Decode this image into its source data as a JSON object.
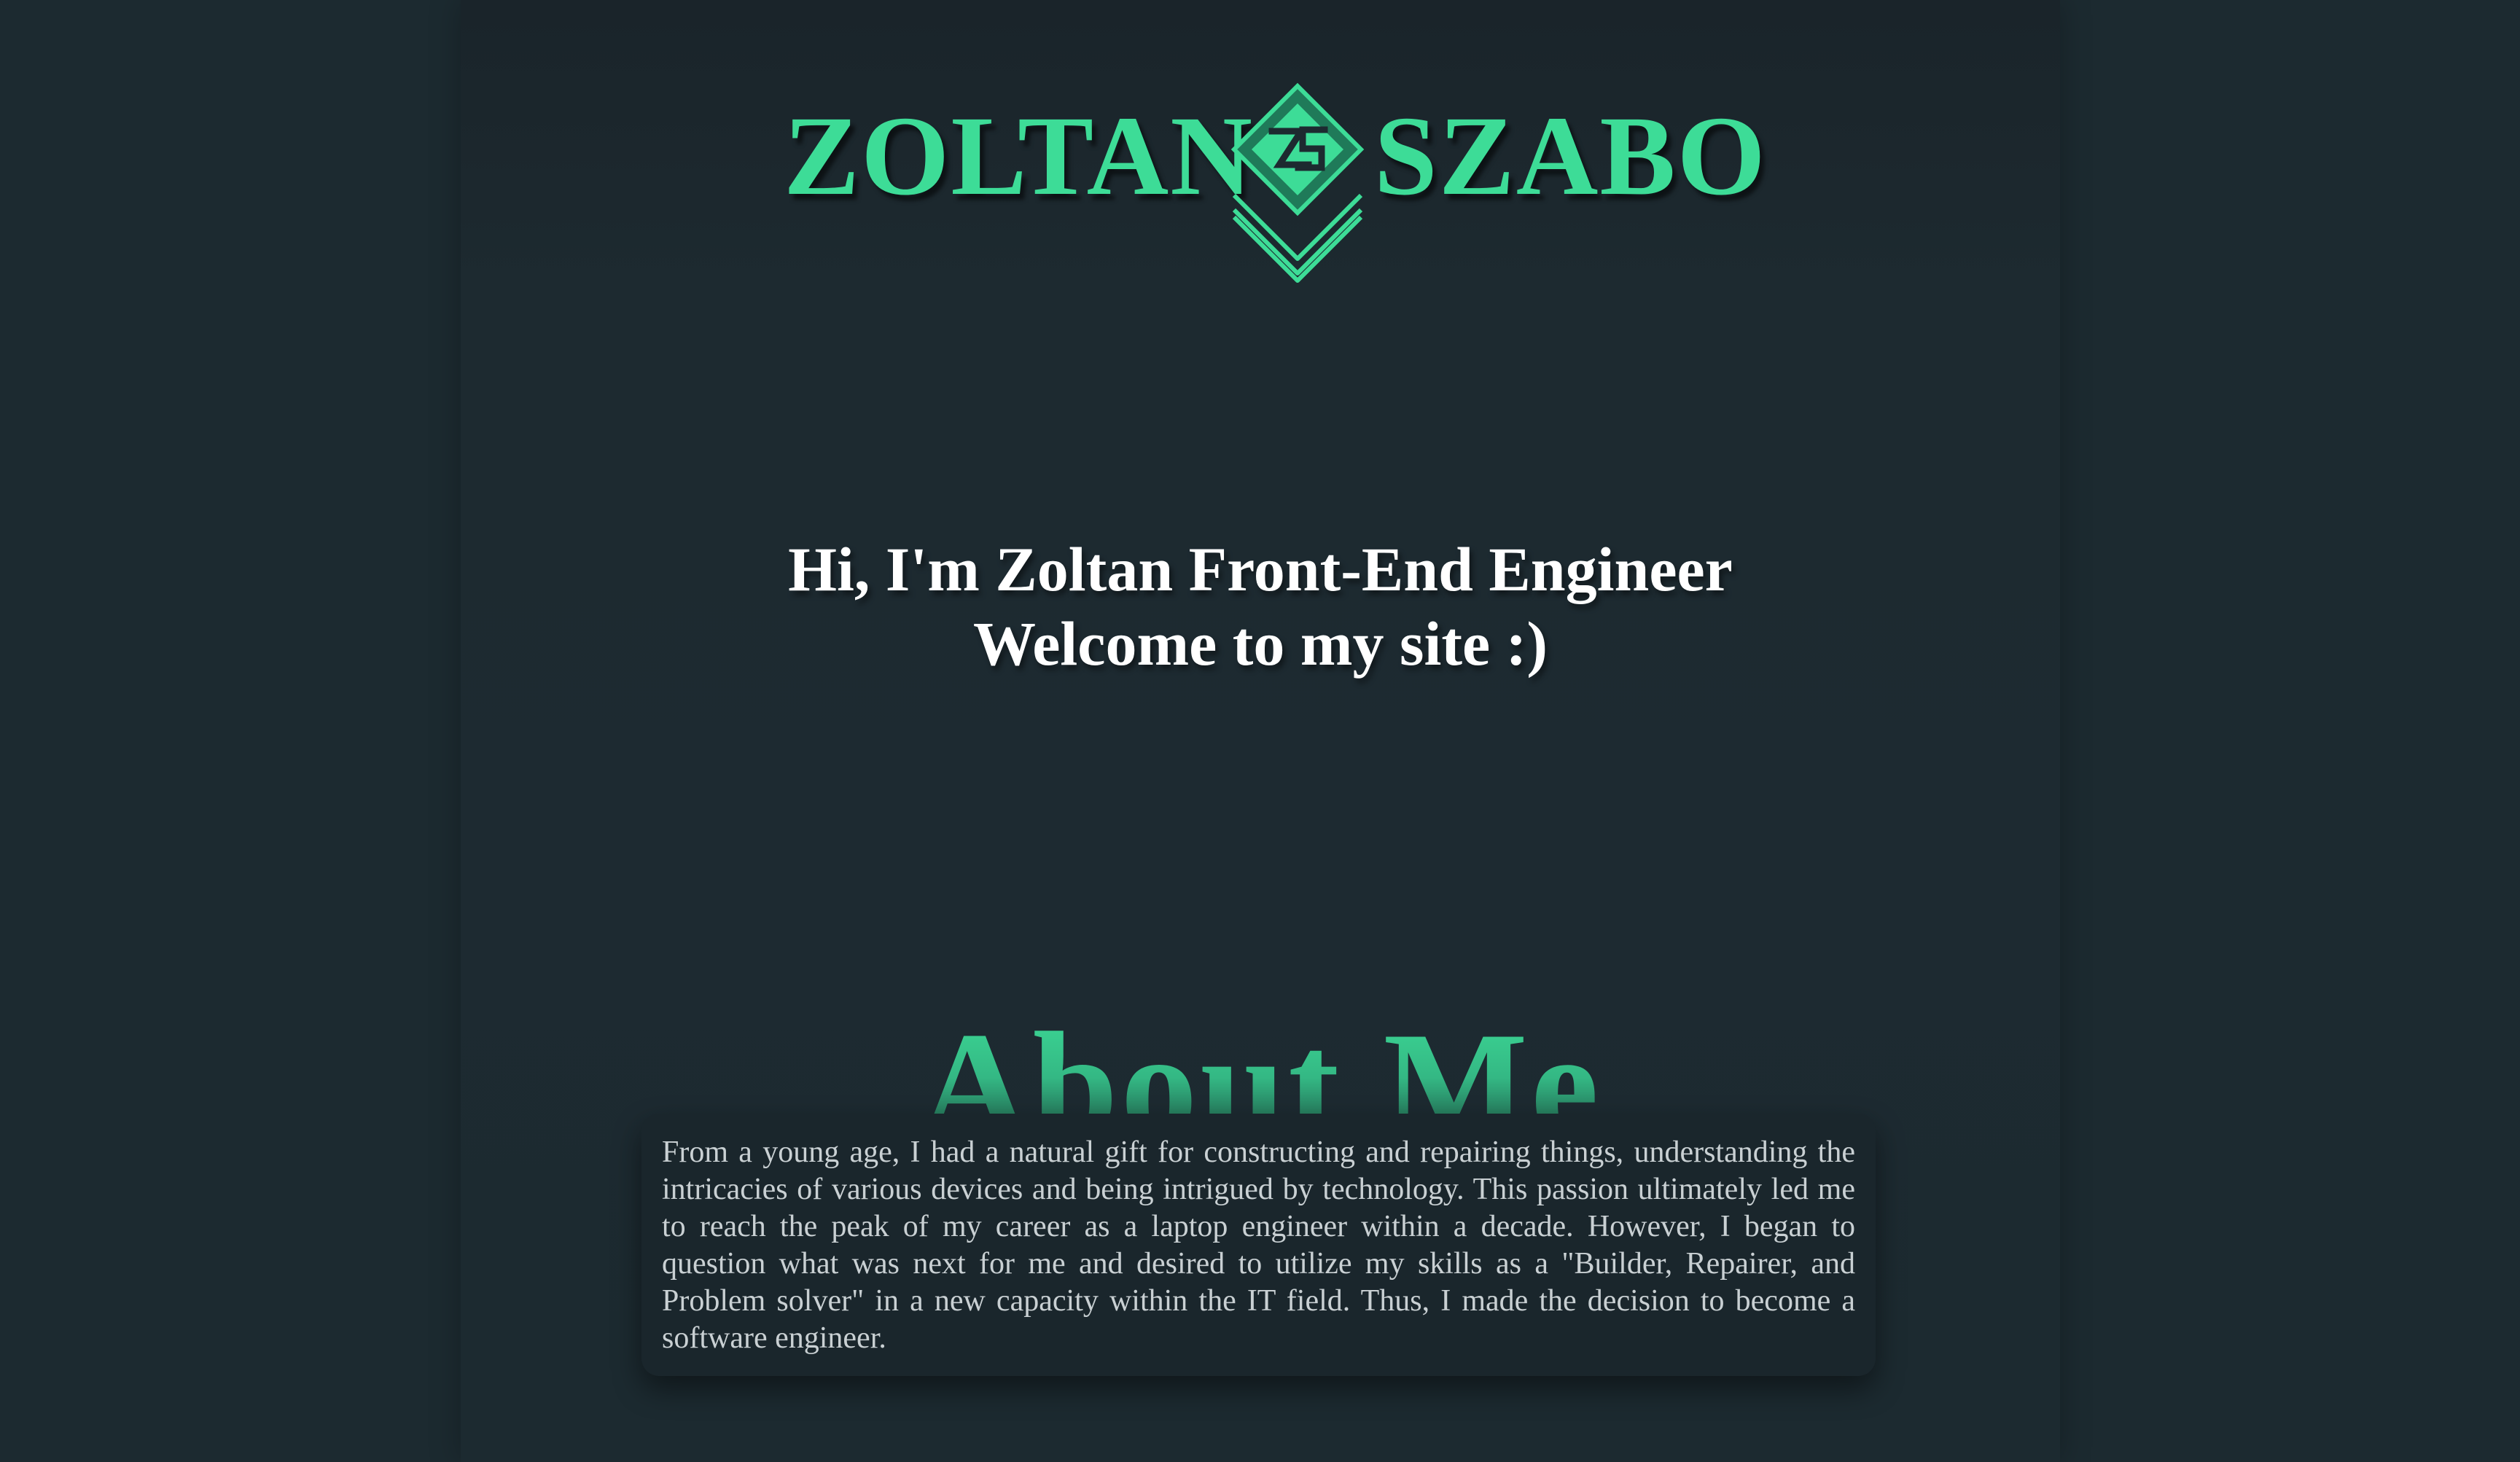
{
  "header": {
    "logo_left": "ZOLTAN",
    "logo_right": "SZABO",
    "logo_mark_icon": "zs-diamond-monogram-icon",
    "brand_color": "#3ddc97"
  },
  "hero": {
    "line1": "Hi, I'm Zoltan Front-End Engineer",
    "line2": "Welcome to my site :)"
  },
  "about": {
    "title": "About Me",
    "body": "From a young age, I had a natural gift for constructing and repairing things, understanding the intricacies of various devices and being intrigued by technology. This passion ultimately led me to reach the peak of my career as a laptop engineer within a decade. However, I began to question what was next for me and desired to utilize my skills as a \"Builder, Repairer, and Problem solver\" in a new capacity within the IT field. Thus, I made the decision to become a software engineer."
  },
  "colors": {
    "background": "#1c2a30",
    "accent": "#3ddc97",
    "text": "#ffffff",
    "body_text": "#c9d0d3"
  }
}
